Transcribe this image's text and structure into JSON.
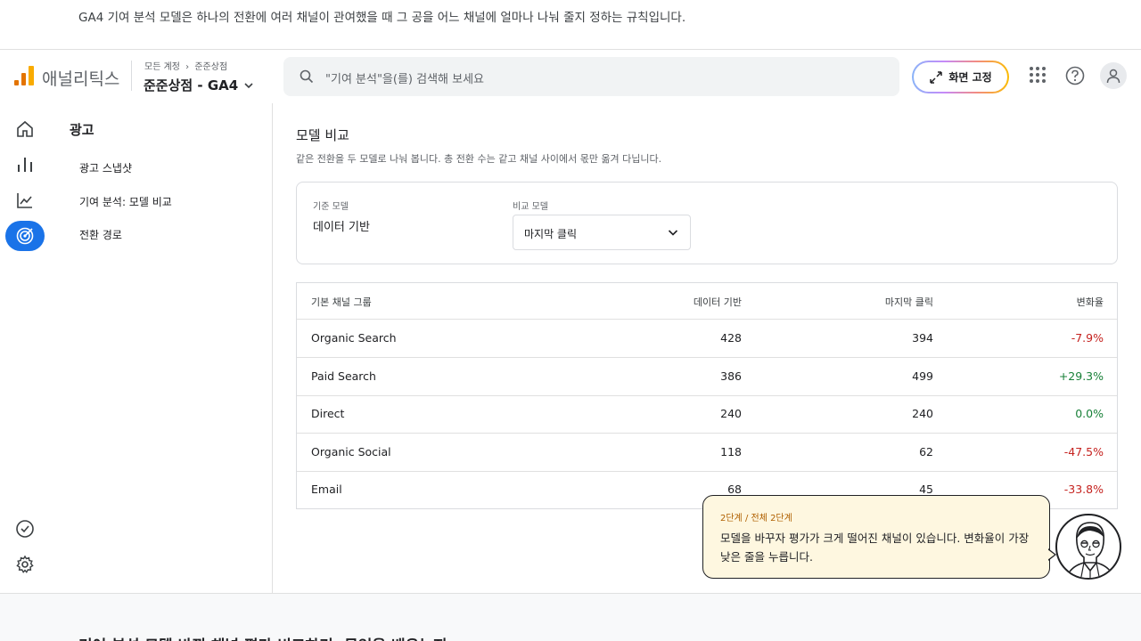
{
  "top_note": "GA4 기여 분석 모델은 하나의 전환에 여러 채널이 관여했을 때 그 공을 어느 채널에 얼마나 나눠 줄지 정하는 규칙입니다.",
  "header": {
    "app_name": "애널리틱스",
    "breadcrumb_root": "모든 계정",
    "breadcrumb_sep": "›",
    "breadcrumb_account": "준준상점",
    "property": "준준상점 - GA4",
    "search_placeholder": "\"기여 분석\"을(를) 검색해 보세요",
    "pin_label": "화면 고정",
    "icons": [
      "apps-grid-icon",
      "help-icon",
      "account-icon"
    ]
  },
  "sidebar": {
    "icons": [
      "home-icon",
      "reports-icon",
      "explore-icon",
      "advertising-icon",
      "admin-check-icon",
      "settings-icon"
    ],
    "active": "advertising-icon"
  },
  "subnav": {
    "title": "광고",
    "items": [
      {
        "label": "광고 스냅샷"
      },
      {
        "label": "기여 분석: 모델 비교"
      },
      {
        "label": "전환 경로"
      }
    ]
  },
  "main": {
    "title": "모델 비교",
    "subtitle": "같은 전환을 두 모델로 나눠 봅니다. 총 전환 수는 같고 채널 사이에서 몫만 옮겨 다닙니다.",
    "base_model_label": "기준 모델",
    "base_model_value": "데이터 기반",
    "compare_model_label": "비교 모델",
    "compare_model_value": "마지막 클릭"
  },
  "table": {
    "headers": [
      "기본 채널 그룹",
      "데이터 기반",
      "마지막 클릭",
      "변화율"
    ],
    "rows": [
      {
        "channel": "Organic Search",
        "data_driven": "428",
        "last_click": "394",
        "change": "-7.9%",
        "trend": "neg"
      },
      {
        "channel": "Paid Search",
        "data_driven": "386",
        "last_click": "499",
        "change": "+29.3%",
        "trend": "pos"
      },
      {
        "channel": "Direct",
        "data_driven": "240",
        "last_click": "240",
        "change": "0.0%",
        "trend": "pos"
      },
      {
        "channel": "Organic Social",
        "data_driven": "118",
        "last_click": "62",
        "change": "-47.5%",
        "trend": "neg"
      },
      {
        "channel": "Email",
        "data_driven": "68",
        "last_click": "45",
        "change": "-33.8%",
        "trend": "neg"
      }
    ]
  },
  "guide": {
    "step": "2단계 / 전체 2단계",
    "message": "모델을 바꾸자 평가가 크게 떨어진 채널이 있습니다. 변화율이 가장 낮은 줄을 누릅니다."
  },
  "bottom_heading": "기여 분석 모델 바꿔 채널 평가 비교하기, 무엇을 배우는지",
  "colors": {
    "accent": "#1a73e8",
    "negative": "#c5221f",
    "positive": "#188038",
    "logo_orange": "#e37400",
    "logo_yellow": "#f9ab00",
    "bubble_bg": "#fef7e0"
  }
}
